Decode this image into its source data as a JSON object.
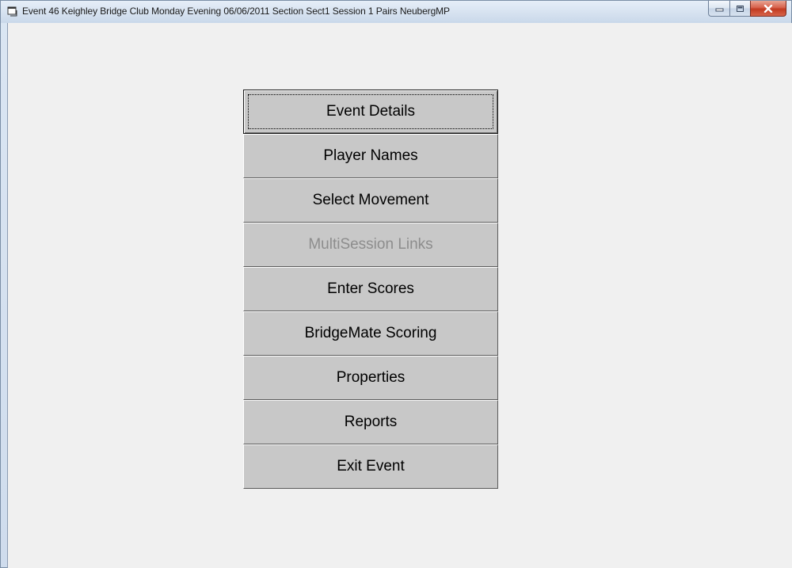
{
  "window": {
    "title": "Event 46   Keighley Bridge Club Monday Evening 06/06/2011 Section Sect1 Session 1 Pairs NeubergMP",
    "app_icon": "window-app-icon",
    "controls": {
      "minimize_icon": "minimize-icon",
      "maximize_icon": "maximize-icon",
      "close_icon": "close-icon"
    }
  },
  "menu": {
    "buttons": [
      {
        "label": "Event Details",
        "state": "focused"
      },
      {
        "label": "Player Names",
        "state": "normal"
      },
      {
        "label": "Select Movement",
        "state": "normal"
      },
      {
        "label": "MultiSession Links",
        "state": "disabled"
      },
      {
        "label": "Enter Scores",
        "state": "normal"
      },
      {
        "label": "BridgeMate Scoring",
        "state": "normal"
      },
      {
        "label": "Properties",
        "state": "normal"
      },
      {
        "label": "Reports",
        "state": "normal"
      },
      {
        "label": "Exit Event",
        "state": "normal"
      }
    ]
  },
  "colors": {
    "button_face": "#c8c8c8",
    "client_background": "#f0f0f0",
    "disabled_text": "#8d8d8d",
    "close_button": "#c23b21"
  }
}
